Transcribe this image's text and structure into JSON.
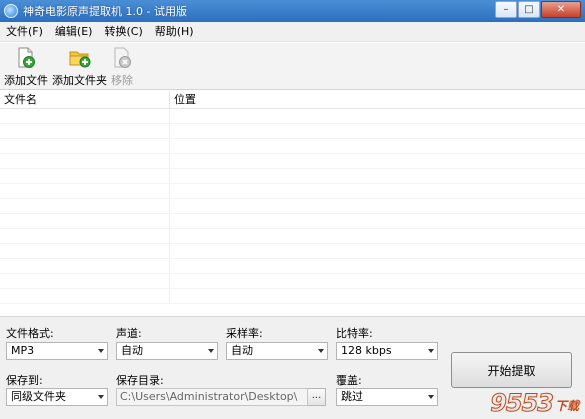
{
  "window": {
    "title": "神奇电影原声提取机 1.0 - 试用版"
  },
  "menu": [
    "文件(F)",
    "编辑(E)",
    "转换(C)",
    "帮助(H)"
  ],
  "toolbar": {
    "add_file": "添加文件",
    "add_folder": "添加文件夹",
    "remove": "移除"
  },
  "list": {
    "columns": [
      "文件名",
      "位置"
    ],
    "rows": []
  },
  "settings": {
    "format_label": "文件格式:",
    "format_value": "MP3",
    "channel_label": "声道:",
    "channel_value": "自动",
    "samplerate_label": "采样率:",
    "samplerate_value": "自动",
    "bitrate_label": "比特率:",
    "bitrate_value": "128 kbps",
    "saveto_label": "保存到:",
    "saveto_value": "同级文件夹",
    "savedir_label": "保存目录:",
    "savedir_value": "C:\\Users\\Administrator\\Desktop\\",
    "browse_label": "...",
    "overwrite_label": "覆盖:",
    "overwrite_value": "跳过"
  },
  "start_button": "开始提取",
  "watermark": {
    "number": "9553",
    "text": "下载"
  },
  "colors": {
    "titlebar": "#2d6fc0",
    "watermark": "#c04a1a"
  }
}
